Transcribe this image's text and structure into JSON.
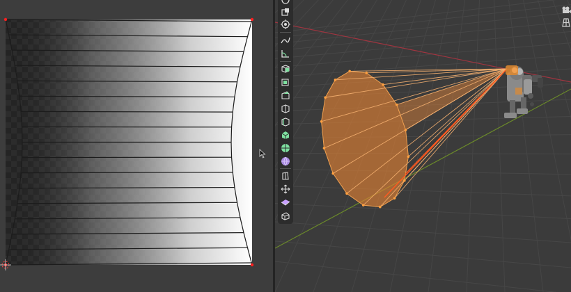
{
  "uv_editor": {
    "image": "gradient-texture",
    "colors": {
      "mesh_edge": "#1c1c1c",
      "selected_vertex": "#ff2020",
      "checker_dark": "#2e2e2e"
    }
  },
  "viewport": {
    "objects": [
      "spot-light-cone",
      "robot-model"
    ],
    "colors": {
      "light_cone": "#f0a050",
      "x_axis": "#a03540",
      "y_axis": "#6b8a2a",
      "grid": "#474747"
    },
    "header_icons": [
      "camera-view-icon",
      "perspective-grid-icon"
    ]
  },
  "toolbar": {
    "tools": [
      {
        "name": "cursor-tool",
        "icon": "cursor-icon"
      },
      {
        "name": "scale-tool",
        "icon": "scale-icon"
      },
      {
        "name": "transform-tool",
        "icon": "transform-icon"
      },
      {
        "name": "annotate-tool",
        "icon": "annotate-icon"
      },
      {
        "name": "measure-tool",
        "icon": "measure-icon"
      },
      {
        "name": "add-cube-tool",
        "icon": "add-cube-icon"
      },
      {
        "name": "extrude-tool",
        "icon": "extrude-icon"
      },
      {
        "name": "inset-tool",
        "icon": "inset-icon"
      },
      {
        "name": "bevel-tool",
        "icon": "bevel-icon"
      },
      {
        "name": "loop-cut-tool",
        "icon": "loop-cut-icon"
      },
      {
        "name": "knife-tool",
        "icon": "knife-icon"
      },
      {
        "name": "poly-build-tool",
        "icon": "poly-build-icon"
      },
      {
        "name": "spin-tool",
        "icon": "spin-icon"
      },
      {
        "name": "smooth-tool",
        "icon": "smooth-icon"
      },
      {
        "name": "edge-slide-tool",
        "icon": "edge-slide-icon"
      },
      {
        "name": "shrink-fatten-tool",
        "icon": "shrink-fatten-icon"
      },
      {
        "name": "shear-tool",
        "icon": "shear-icon"
      },
      {
        "name": "rip-region-tool",
        "icon": "rip-region-icon"
      }
    ]
  }
}
